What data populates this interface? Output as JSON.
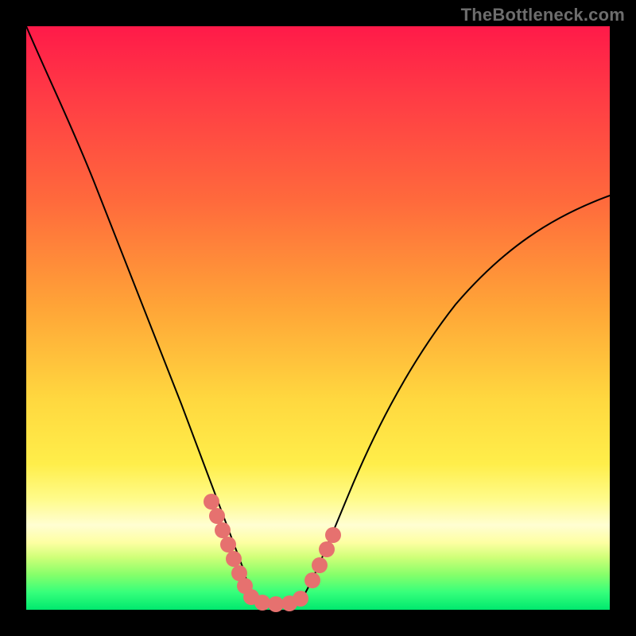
{
  "watermark": "TheBottleneck.com",
  "colors": {
    "frame_bg": "#000000",
    "watermark_text": "#6d6d6d",
    "curve_stroke": "#000000",
    "marker_fill": "#e6716f"
  },
  "chart_data": {
    "type": "line",
    "title": "",
    "xlabel": "",
    "ylabel": "",
    "xlim": [
      0,
      100
    ],
    "ylim": [
      0,
      100
    ],
    "grid": false,
    "legend": false,
    "note": "No axis ticks or numeric labels are rendered in the image; x/y are expressed as percentages of the plot area (0–100). y=100 is top, y=0 is bottom.",
    "series": [
      {
        "name": "left-curve",
        "x": [
          0,
          4,
          8,
          12,
          16,
          20,
          24,
          28,
          31,
          34,
          36.5,
          38.5
        ],
        "y": [
          100,
          92,
          83,
          73,
          62,
          51,
          40,
          29,
          19,
          10,
          4,
          1.5
        ]
      },
      {
        "name": "bottom-flat",
        "x": [
          38.5,
          41,
          44,
          47
        ],
        "y": [
          1.5,
          1,
          1,
          1.5
        ]
      },
      {
        "name": "right-curve",
        "x": [
          47,
          50,
          54,
          59,
          65,
          72,
          80,
          88,
          95,
          100
        ],
        "y": [
          1.5,
          6,
          15,
          26,
          38,
          49,
          58,
          65,
          69,
          71
        ]
      }
    ],
    "markers": {
      "description": "Thick pinkish segments overlaid near the bottom of the V, on each outer limb.",
      "color": "#e6716f",
      "left_segment": {
        "x_range": [
          31.5,
          38.5
        ],
        "y_range": [
          18,
          1.5
        ]
      },
      "right_segment": {
        "x_range": [
          47,
          52
        ],
        "y_range": [
          1.5,
          11
        ]
      }
    }
  }
}
